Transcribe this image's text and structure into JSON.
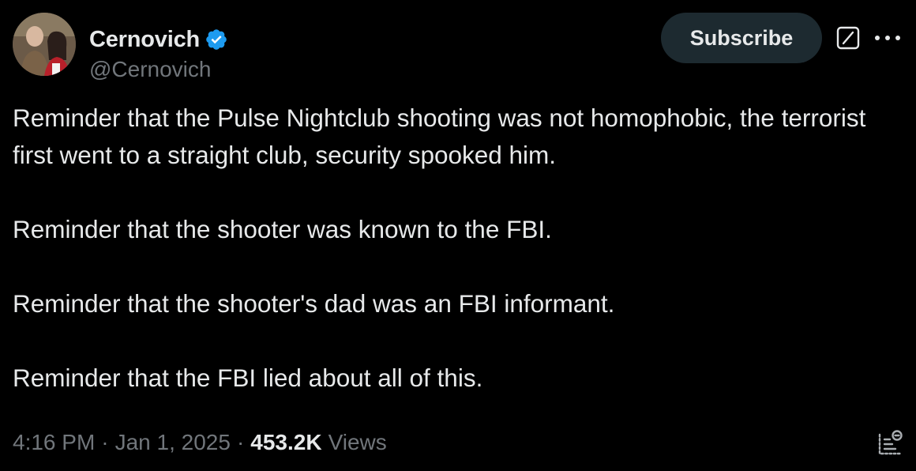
{
  "author": {
    "display_name": "Cernovich",
    "handle": "@Cernovich",
    "verified": true
  },
  "actions": {
    "subscribe_label": "Subscribe"
  },
  "tweet": {
    "paragraphs": [
      "Reminder that the Pulse Nightclub shooting was not homophobic, the terrorist first went to a straight club, security spooked him.",
      "Reminder that the shooter was known to the FBI.",
      "Reminder that the shooter's dad was an FBI informant.",
      "Reminder that the FBI lied about all of this."
    ],
    "time": "4:16 PM",
    "date": "Jan 1, 2025",
    "separator": "·",
    "views_count": "453.2K",
    "views_label": "Views"
  },
  "icons": {
    "verified": "verified-badge-icon",
    "grok": "grok-icon",
    "more": "more-icon",
    "analytics": "analytics-icon"
  },
  "colors": {
    "background": "#000000",
    "text_primary": "#e7e9ea",
    "text_secondary": "#71767b",
    "verified_blue": "#1d9bf0",
    "subscribe_bg": "#1d2a30"
  }
}
